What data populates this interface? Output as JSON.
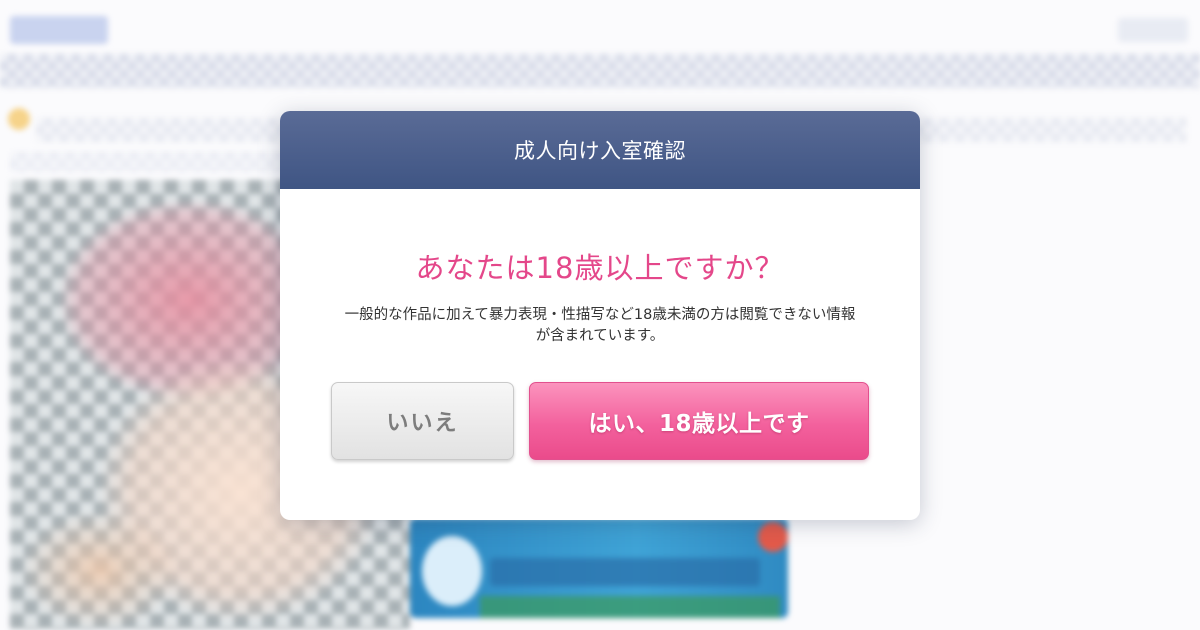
{
  "modal": {
    "title": "成人向け入室確認",
    "question": "あなたは18歳以上ですか？",
    "description_line1": "一般的な作品に加えて暴力表現・性描写など18歳未満の方は閲覧できない情報",
    "description_line2": "が含まれています。",
    "no_button_label": "いいえ",
    "yes_button_label": "はい、18歳以上です"
  },
  "colors": {
    "header_bg": "#46588a",
    "question_text": "#e4478a",
    "yes_button": "#f3619d",
    "no_button": "#e8e8e8"
  }
}
